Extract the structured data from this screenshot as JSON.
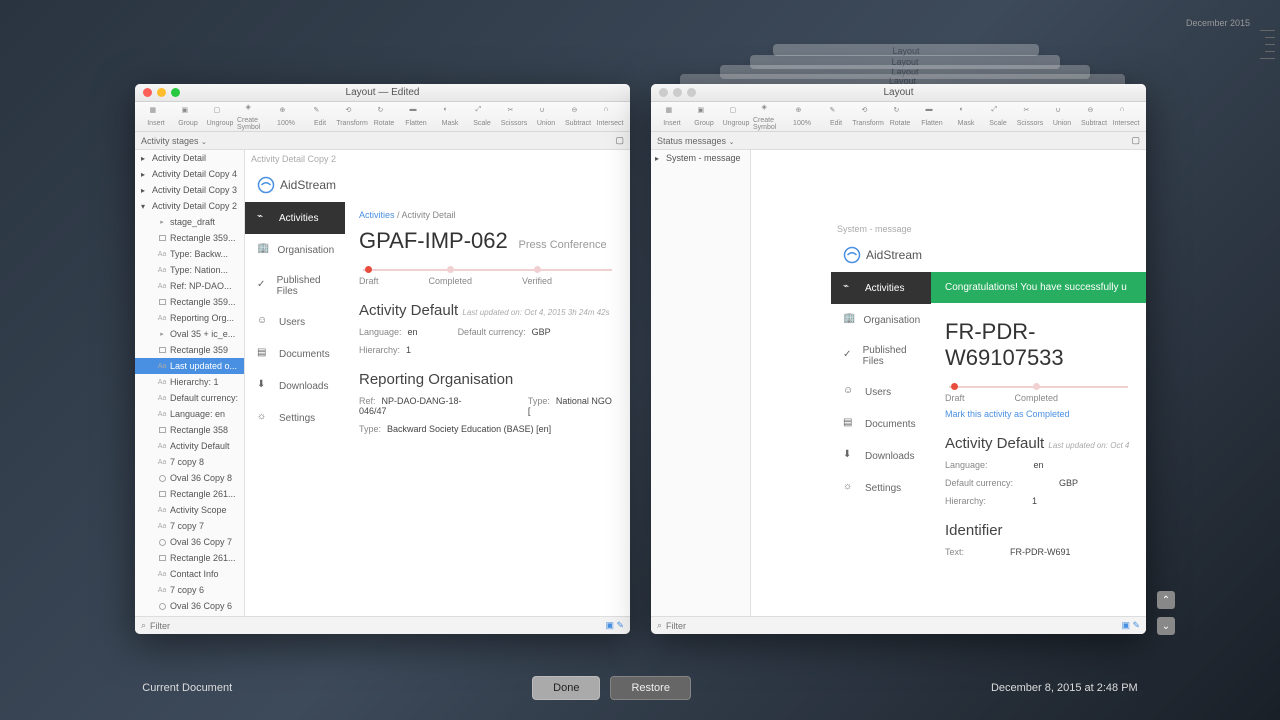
{
  "timeline": {
    "label": "December 2015"
  },
  "bottom": {
    "left_caption": "Current Document",
    "done": "Done",
    "restore": "Restore",
    "right_caption": "December 8, 2015 at 2:48 PM"
  },
  "ghost_title": "Layout",
  "window_left": {
    "title": "Layout — Edited",
    "inspector_label": "Activity stages",
    "artboard_label": "Activity Detail Copy 2",
    "filter_placeholder": "Filter"
  },
  "window_right": {
    "title": "Layout",
    "inspector_label": "Status messages",
    "layer1": "System - message",
    "artboard_label": "System - message",
    "filter_placeholder": "Filter"
  },
  "toolbar": {
    "insert": "Insert",
    "group": "Group",
    "ungroup": "Ungroup",
    "create_symbol": "Create Symbol",
    "zoom": "100%",
    "edit": "Edit",
    "transform": "Transform",
    "rotate": "Rotate",
    "flatten": "Flatten",
    "mask": "Mask",
    "scale": "Scale",
    "scissors": "Scissors",
    "union": "Union",
    "subtract": "Subtract",
    "intersect": "Intersect"
  },
  "layers_left": [
    "Activity Detail",
    "Activity Detail Copy 4",
    "Activity Detail Copy 3",
    "Activity Detail Copy 2",
    "stage_draft",
    "Rectangle 359...",
    "Type:  Backw...",
    "Type:  Nation...",
    "Ref:  NP-DAO...",
    "Rectangle 359...",
    "Reporting Org...",
    "Oval 35 + ic_e...",
    "Rectangle 359",
    "Last updated o...",
    "Hierarchy:  1",
    "Default currency:",
    "Language:  en",
    "Rectangle 358",
    "Activity Default",
    "7 copy 8",
    "Oval 36 Copy 8",
    "Rectangle 261...",
    "Activity Scope",
    "7 copy 7",
    "Oval 36 Copy 7",
    "Rectangle 261...",
    "Contact Info",
    "7 copy 6",
    "Oval 36 Copy 6"
  ],
  "brand": "AidStream",
  "nav": {
    "activities": "Activities",
    "organisation": "Organisation",
    "published": "Published Files",
    "users": "Users",
    "documents": "Documents",
    "downloads": "Downloads",
    "settings": "Settings"
  },
  "left_art": {
    "crumb_link": "Activities",
    "crumb_sep": " / ",
    "crumb_cur": "Activity Detail",
    "title": "GPAF-IMP-062",
    "subtitle": "Press Conference",
    "stages": [
      "Draft",
      "Completed",
      "Verified"
    ],
    "section1": "Activity Default",
    "updated_label": "Last updated on:",
    "updated_val": "Oct 4, 2015 3h 24m 42s",
    "lang_k": "Language:",
    "lang_v": "en",
    "cur_k": "Default currency:",
    "cur_v": "GBP",
    "hier_k": "Hierarchy:",
    "hier_v": "1",
    "section2": "Reporting Organisation",
    "ref_k": "Ref:",
    "ref_v": "NP-DAO-DANG-18-046/47",
    "type_k": "Type:",
    "type_v": "National NGO [",
    "type2_k": "Type:",
    "type2_v": "Backward Society Education (BASE) [en]"
  },
  "right_art": {
    "banner": "Congratulations! You have successfully u",
    "title": "FR-PDR-W69107533",
    "stages": [
      "Draft",
      "Completed"
    ],
    "marklink": "Mark this activity as Completed",
    "section1": "Activity Default",
    "updated_label": "Last updated on:",
    "updated_val": "Oct 4",
    "lang_k": "Language:",
    "lang_v": "en",
    "cur_k": "Default currency:",
    "cur_v": "GBP",
    "hier_k": "Hierarchy:",
    "hier_v": "1",
    "section2": "Identifier",
    "text_k": "Text:",
    "text_v": "FR-PDR-W691"
  }
}
